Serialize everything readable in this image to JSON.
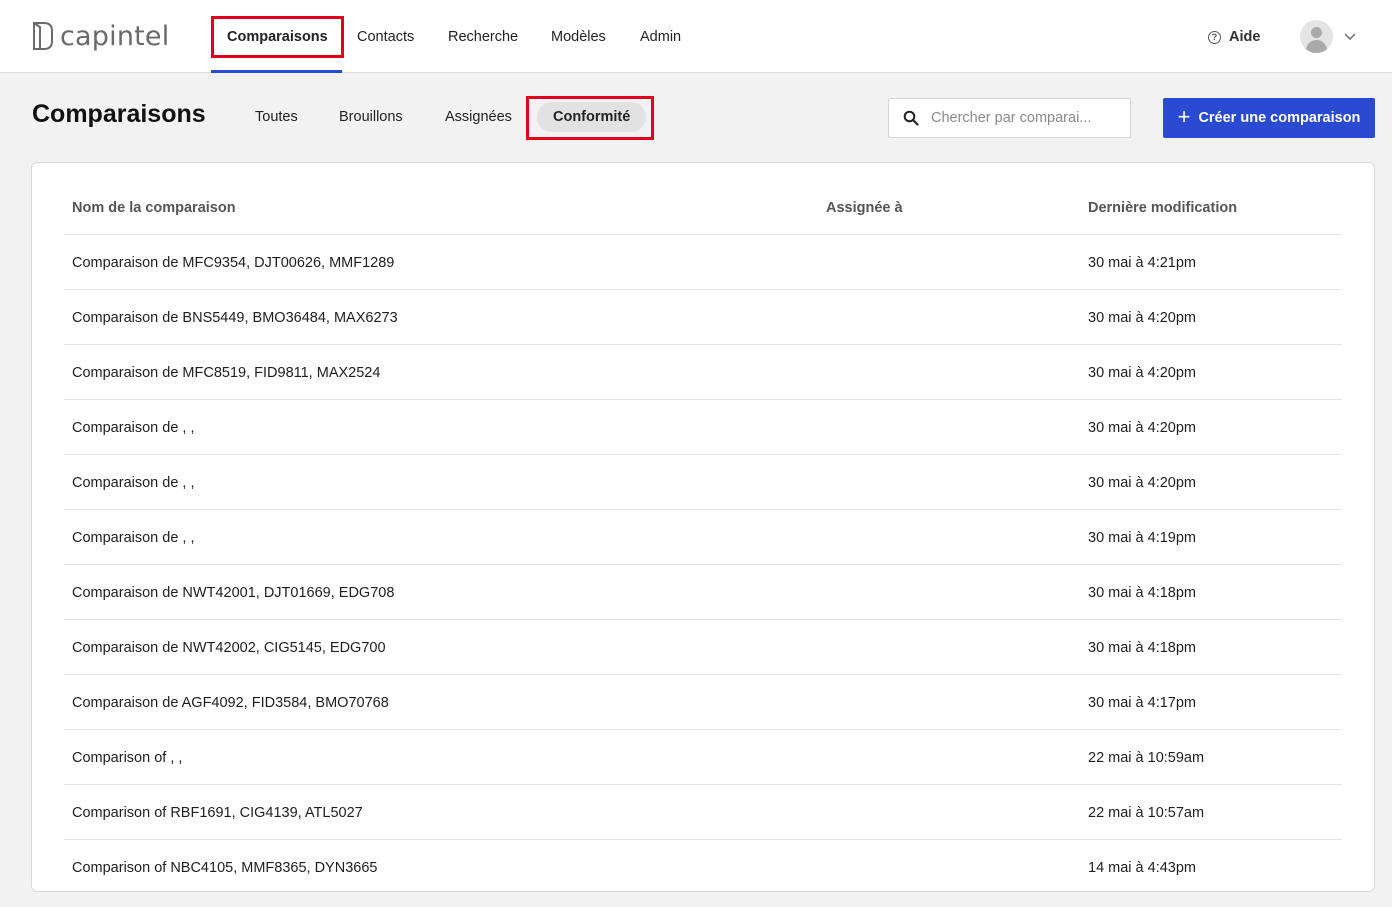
{
  "app": {
    "logo_text": "capintel"
  },
  "nav": {
    "items": [
      {
        "label": "Comparaisons",
        "active": true
      },
      {
        "label": "Contacts",
        "active": false
      },
      {
        "label": "Recherche",
        "active": false
      },
      {
        "label": "Modèles",
        "active": false
      },
      {
        "label": "Admin",
        "active": false
      }
    ],
    "help_label": "Aide"
  },
  "header": {
    "title": "Comparaisons",
    "tabs": [
      {
        "label": "Toutes",
        "active": false
      },
      {
        "label": "Brouillons",
        "active": false
      },
      {
        "label": "Assignées",
        "active": false
      },
      {
        "label": "Conformité",
        "active": true
      }
    ],
    "search": {
      "placeholder": "Chercher par comparai...",
      "value": ""
    },
    "create_button_label": "Créer une comparaison"
  },
  "table": {
    "columns": [
      "Nom de la comparaison",
      "Assignée à",
      "Dernière modification"
    ],
    "rows": [
      {
        "name": "Comparaison de MFC9354, DJT00626, MMF1289",
        "assigned": "",
        "modified": "30 mai à 4:21pm"
      },
      {
        "name": "Comparaison de BNS5449, BMO36484, MAX6273",
        "assigned": "",
        "modified": "30 mai à 4:20pm"
      },
      {
        "name": "Comparaison de MFC8519, FID9811, MAX2524",
        "assigned": "",
        "modified": "30 mai à 4:20pm"
      },
      {
        "name": "Comparaison de , ,",
        "assigned": "",
        "modified": "30 mai à 4:20pm"
      },
      {
        "name": "Comparaison de , ,",
        "assigned": "",
        "modified": "30 mai à 4:20pm"
      },
      {
        "name": "Comparaison de , ,",
        "assigned": "",
        "modified": "30 mai à 4:19pm"
      },
      {
        "name": "Comparaison de NWT42001, DJT01669, EDG708",
        "assigned": "",
        "modified": "30 mai à 4:18pm"
      },
      {
        "name": "Comparaison de NWT42002, CIG5145, EDG700",
        "assigned": "",
        "modified": "30 mai à 4:18pm"
      },
      {
        "name": "Comparaison de AGF4092, FID3584, BMO70768",
        "assigned": "",
        "modified": "30 mai à 4:17pm"
      },
      {
        "name": "Comparison of , ,",
        "assigned": "",
        "modified": "22 mai à 10:59am"
      },
      {
        "name": "Comparison of RBF1691, CIG4139, ATL5027",
        "assigned": "",
        "modified": "22 mai à 10:57am"
      },
      {
        "name": "Comparison of NBC4105, MMF8365, DYN3665",
        "assigned": "",
        "modified": "14 mai à 4:43pm"
      }
    ]
  },
  "colors": {
    "accent": "#2a4bd1",
    "highlight": "#e3001b"
  }
}
